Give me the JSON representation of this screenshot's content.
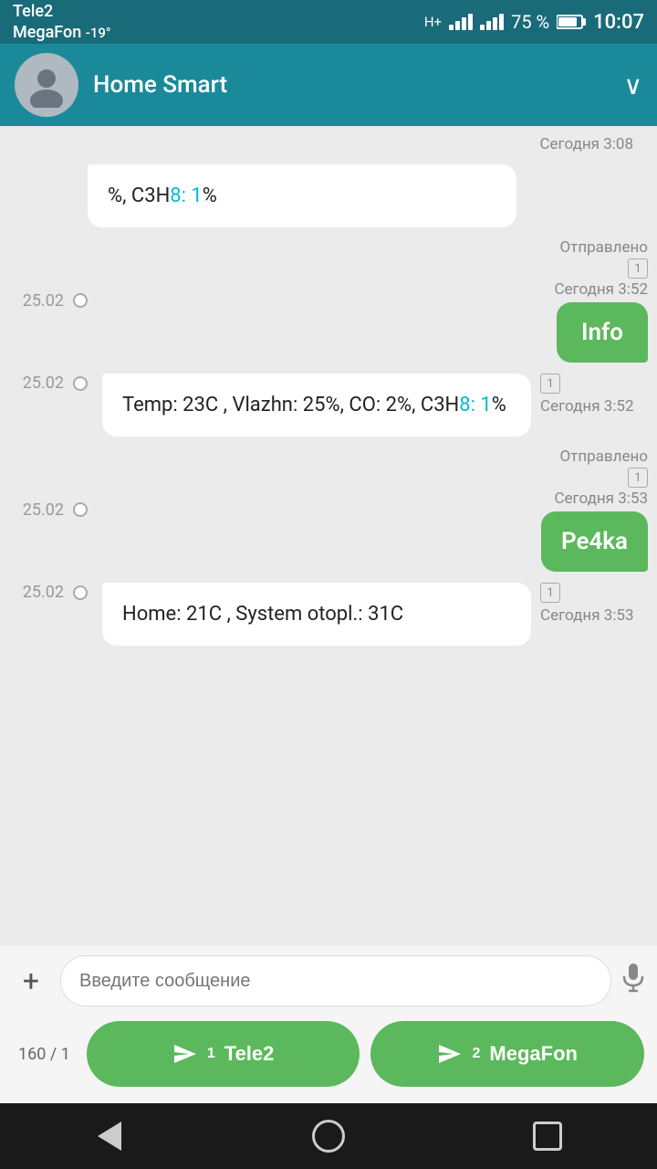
{
  "statusBar": {
    "carrier": "Tele2",
    "network": "MegaFon",
    "temp": "-19°",
    "hPlus": "H+",
    "battery": "75 %",
    "time": "10:07"
  },
  "header": {
    "title": "Home Smart",
    "chevron": "∨"
  },
  "messages": [
    {
      "id": "partial-top",
      "type": "partial-received",
      "date": "",
      "text": "%, С3Н",
      "link": "8: 1",
      "textAfter": "%",
      "time": "Сегодня 3:08"
    },
    {
      "id": "msg-info-sent",
      "type": "sent",
      "date": "25.02",
      "metaLabel": "Отправлено",
      "metaNum": "1",
      "time": "Сегодня 3:52",
      "bubble": "Info"
    },
    {
      "id": "msg-received-1",
      "type": "received",
      "date": "25.02",
      "metaNum": "1",
      "time": "Сегодня 3:52",
      "textParts": [
        "Temp: 23C , Vlazhn: 25%, CO: 2%, С3Н",
        "8: 1",
        "%"
      ]
    },
    {
      "id": "msg-pe4ka-sent",
      "type": "sent",
      "date": "25.02",
      "metaLabel": "Отправлено",
      "metaNum": "1",
      "time": "Сегодня 3:53",
      "bubble": "Pe4ka"
    },
    {
      "id": "msg-received-2",
      "type": "received",
      "date": "25.02",
      "metaNum": "1",
      "time": "Сегодня 3:53",
      "textParts": [
        "Home: 21C , System otopl.: 31C"
      ]
    }
  ],
  "inputArea": {
    "placeholder": "Введите сообщение",
    "plusIcon": "+"
  },
  "sendRow": {
    "counter": "160 / 1",
    "btn1Label": "Tele2",
    "btn1Sub": "1",
    "btn2Label": "MegaFon",
    "btn2Sub": "2"
  },
  "navBar": {
    "back": "back",
    "home": "home",
    "recent": "recent"
  }
}
